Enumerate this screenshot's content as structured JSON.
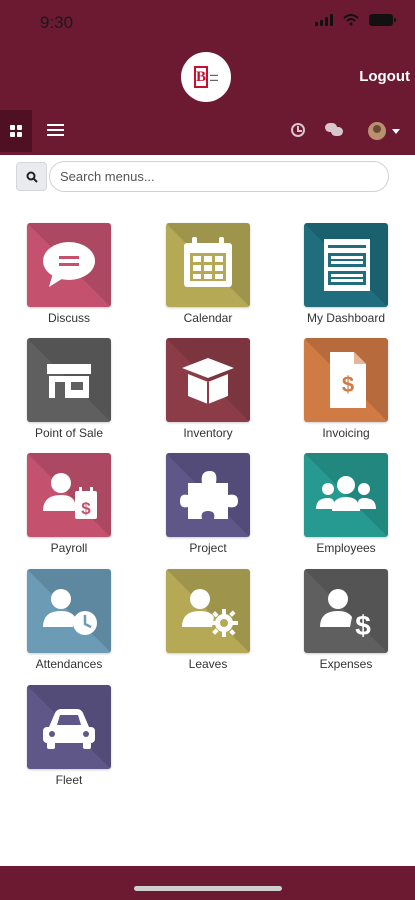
{
  "status_bar": {
    "time": "9:30"
  },
  "header": {
    "logout_label": "Logout",
    "logo_alt": "B"
  },
  "search": {
    "placeholder": "Search menus..."
  },
  "apps": [
    {
      "label": "Discuss",
      "color": "#c4526f",
      "icon": "chat-bubble-icon"
    },
    {
      "label": "Calendar",
      "color": "#b5a955",
      "icon": "calendar-icon"
    },
    {
      "label": "My Dashboard",
      "color": "#1f6d7d",
      "icon": "dashboard-icon"
    },
    {
      "label": "Point of Sale",
      "color": "#5f5f5f",
      "icon": "store-icon"
    },
    {
      "label": "Inventory",
      "color": "#8b3c47",
      "icon": "box-icon"
    },
    {
      "label": "Invoicing",
      "color": "#d07a44",
      "icon": "invoice-icon"
    },
    {
      "label": "Payroll",
      "color": "#c4526f",
      "icon": "payroll-icon"
    },
    {
      "label": "Project",
      "color": "#5e5788",
      "icon": "puzzle-icon"
    },
    {
      "label": "Employees",
      "color": "#269a90",
      "icon": "people-icon"
    },
    {
      "label": "Attendances",
      "color": "#6b9bb5",
      "icon": "user-clock-icon"
    },
    {
      "label": "Leaves",
      "color": "#b5a955",
      "icon": "user-gear-icon"
    },
    {
      "label": "Expenses",
      "color": "#5f5f5f",
      "icon": "user-dollar-icon"
    },
    {
      "label": "Fleet",
      "color": "#5e5788",
      "icon": "car-icon"
    }
  ]
}
